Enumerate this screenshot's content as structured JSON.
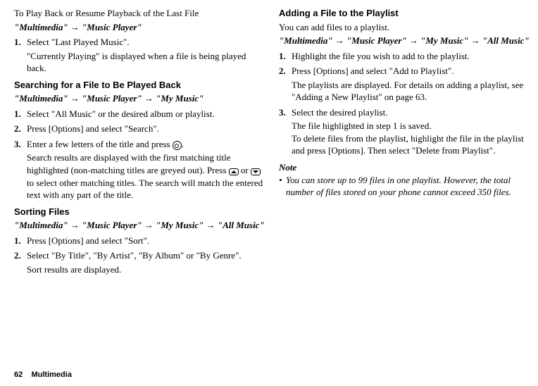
{
  "left": {
    "playback_title": "To Play Back or Resume Playback of the Last File",
    "playback_path": "\"Multimedia\" → \"Music Player\"",
    "playback_steps": [
      {
        "num": "1.",
        "text": "Select \"Last Played Music\".",
        "extra": "\"Currently Playing\" is displayed when a file is being played back."
      }
    ],
    "search_title": "Searching for a File to Be Played Back",
    "search_path": "\"Multimedia\" → \"Music Player\" → \"My Music\"",
    "search_steps": [
      {
        "num": "1.",
        "text": "Select \"All Music\" or the desired album or playlist."
      },
      {
        "num": "2.",
        "text": "Press [Options] and select \"Search\"."
      },
      {
        "num": "3.",
        "text_a": "Enter a few letters of the title and press ",
        "text_b": ".",
        "extra_a": "Search results are displayed with the first matching title highlighted (non-matching titles are greyed out). Press ",
        "extra_b": " or ",
        "extra_c": " to select other matching titles. The search will match the entered text with any part of the title."
      }
    ],
    "sort_title": "Sorting Files",
    "sort_path": "\"Multimedia\" → \"Music Player\" → \"My Music\" → \"All Music\"",
    "sort_steps": [
      {
        "num": "1.",
        "text": "Press [Options] and select \"Sort\"."
      },
      {
        "num": "2.",
        "text": "Select \"By Title\", \"By Artist\", \"By Album\" or \"By Genre\".",
        "extra": "Sort results are displayed."
      }
    ]
  },
  "right": {
    "add_title": "Adding a File to the Playlist",
    "add_intro": "You can add files to a playlist.",
    "add_path": "\"Multimedia\" → \"Music Player\" → \"My Music\" → \"All Music\"",
    "add_steps": [
      {
        "num": "1.",
        "text": "Highlight the file you wish to add to the playlist."
      },
      {
        "num": "2.",
        "text": "Press [Options] and select \"Add to Playlist\".",
        "extra": "The playlists are displayed. For details on adding a playlist, see \"Adding a New Playlist\" on page 63."
      },
      {
        "num": "3.",
        "text": "Select the desired playlist.",
        "extra": "The file highlighted in step 1 is saved.\nTo delete files from the playlist, highlight the file in the playlist and press [Options]. Then select \"Delete from Playlist\"."
      }
    ],
    "note_lbl": "Note",
    "note_body": "You can store up to 99 files in one playlist. However, the total number of files stored on your phone cannot exceed 350 files."
  },
  "footer": {
    "page": "62",
    "section": "Multimedia"
  }
}
